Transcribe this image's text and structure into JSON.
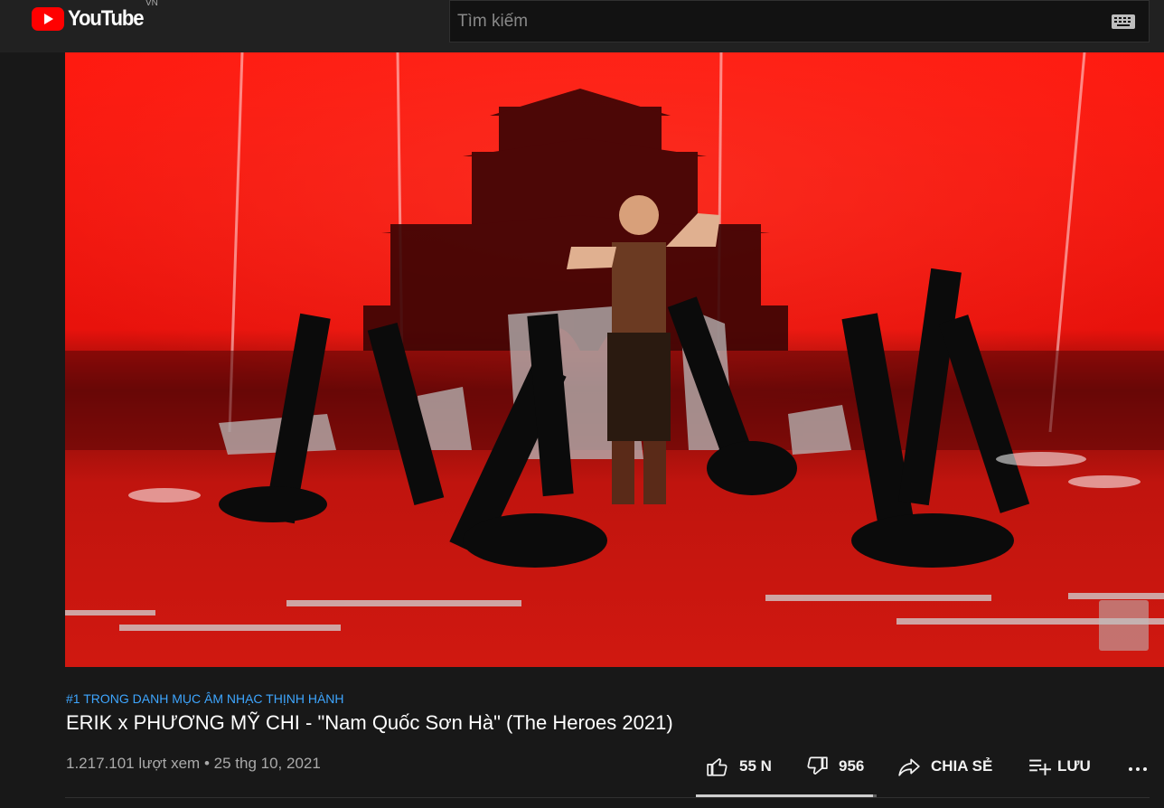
{
  "masthead": {
    "logo_text": "YouTube",
    "country_code": "VN",
    "search_placeholder": "Tìm kiếm"
  },
  "video": {
    "hashtag": "#1 TRONG DANH MỤC ÂM NHẠC THỊNH HÀNH",
    "title": "ERIK x PHƯƠNG MỸ CHI - \"Nam Quốc Sơn Hà\" (The Heroes 2021)",
    "views": "1.217.101 lượt xem",
    "separator": "•",
    "date": "25 thg 10, 2021"
  },
  "actions": {
    "like_count": "55 N",
    "dislike_count": "956",
    "share_label": "CHIA SẺ",
    "save_label": "LƯU",
    "more_label": "..."
  },
  "sentiment_like_ratio": 0.98,
  "icons": {
    "logo": "youtube-play-icon",
    "keyboard": "keyboard-icon",
    "like": "thumbs-up-icon",
    "dislike": "thumbs-down-icon",
    "share": "share-arrow-icon",
    "save": "playlist-add-icon",
    "more": "more-horizontal-icon"
  },
  "colors": {
    "brand_red": "#ff0000",
    "link_blue": "#3ea6ff",
    "background": "#181818"
  }
}
